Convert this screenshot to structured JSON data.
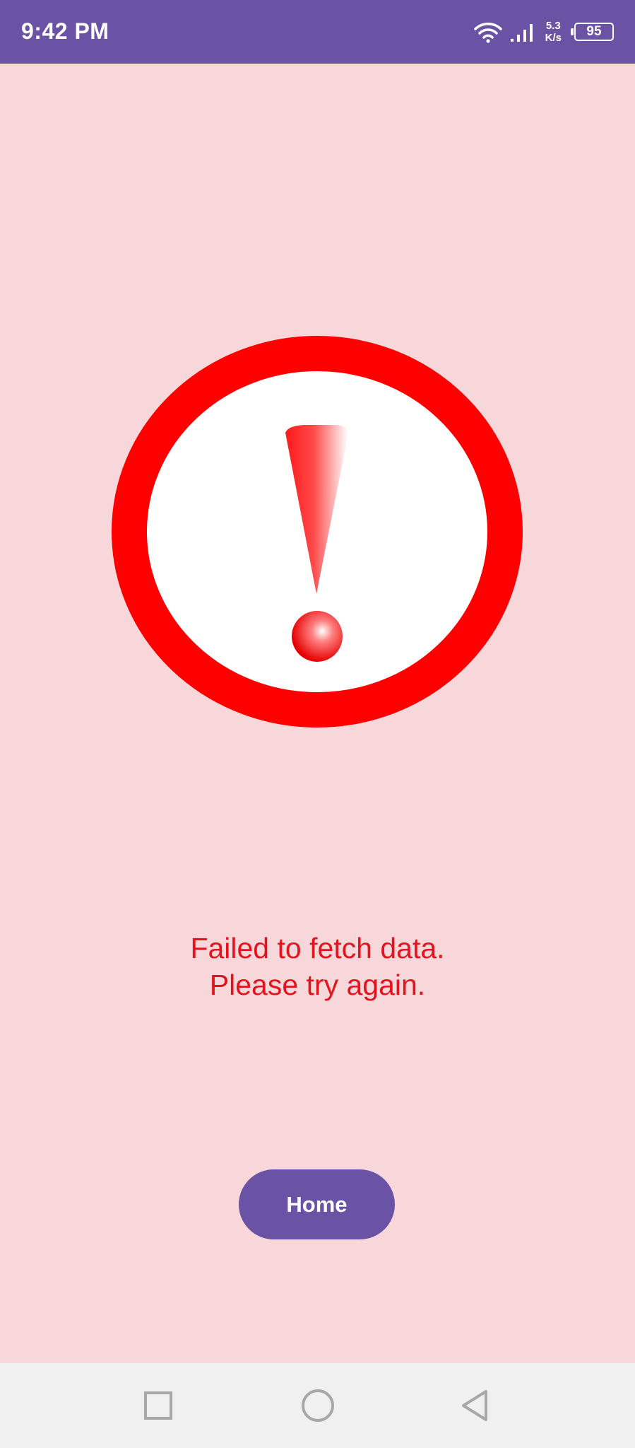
{
  "status_bar": {
    "time": "9:42 PM",
    "net_speed_value": "5.3",
    "net_speed_unit": "K/s",
    "battery_level": "95",
    "background_color": "#6a52a5"
  },
  "alert": {
    "icon": "exclamation-warning-icon",
    "ring_color": "#ff0000"
  },
  "error": {
    "message": "Failed to fetch data.\n Please try again.",
    "color": "#e3141c"
  },
  "home_button": {
    "label": "Home",
    "color": "#6a52a5"
  },
  "nav_bar": {
    "icons": [
      "recents-square-icon",
      "home-circle-icon",
      "back-triangle-icon"
    ]
  },
  "page": {
    "background_color": "#f8d7da"
  }
}
